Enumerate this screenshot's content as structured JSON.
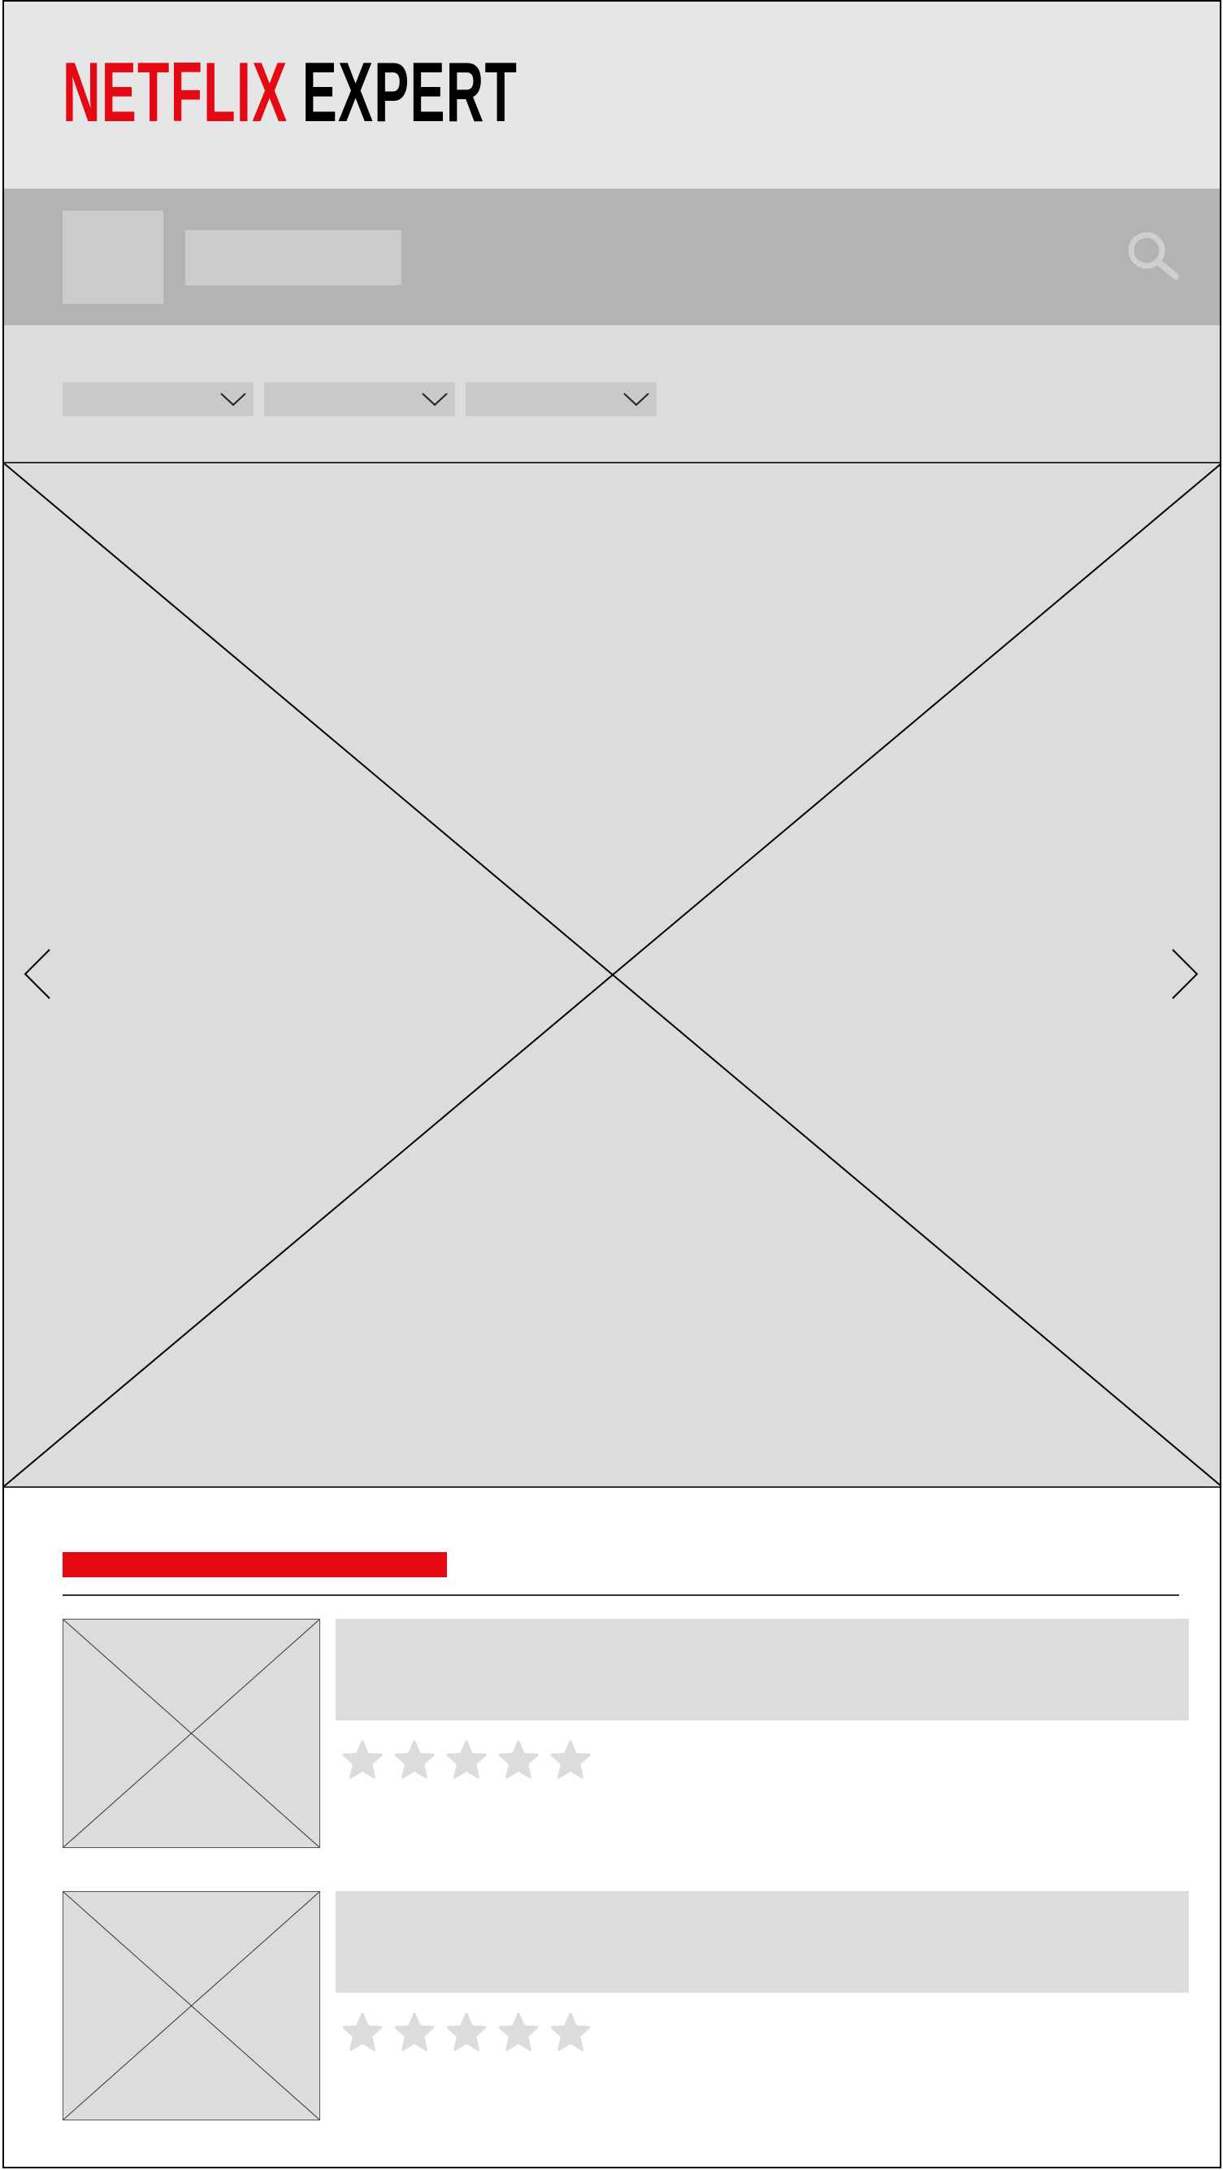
{
  "app": {
    "logo_brand": "NETFLIX",
    "logo_suffix": "EXPERT",
    "brand_color": "#e50914"
  },
  "toolbar": {
    "search_icon": "search-icon"
  },
  "filters": {
    "dropdowns": [
      {
        "icon": "chevron-down-icon"
      },
      {
        "icon": "chevron-down-icon"
      },
      {
        "icon": "chevron-down-icon"
      }
    ]
  },
  "hero": {
    "prev_icon": "chevron-left-icon",
    "next_icon": "chevron-right-icon"
  },
  "cards": [
    {
      "rating_max": 5,
      "rating_icon": "star-icon"
    },
    {
      "rating_max": 5,
      "rating_icon": "star-icon"
    }
  ]
}
